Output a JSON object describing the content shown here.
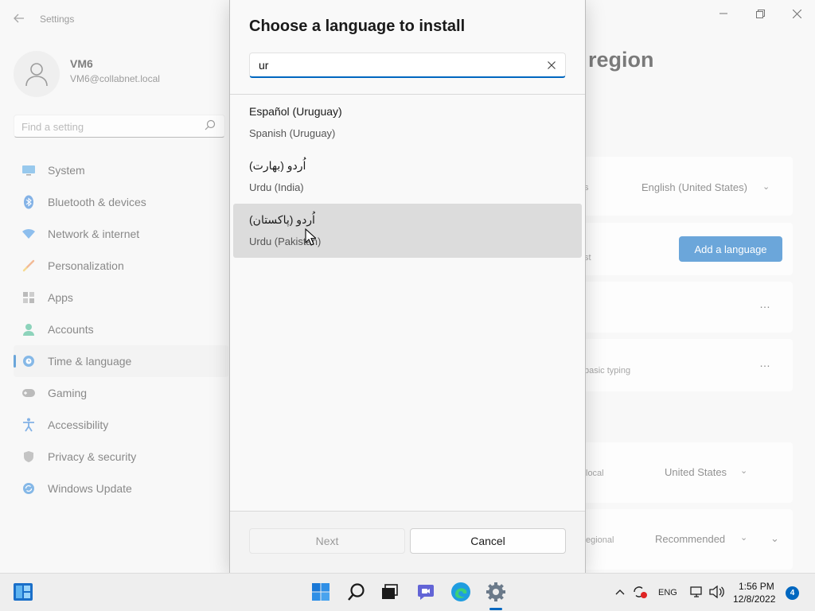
{
  "settings": {
    "app_title": "Settings",
    "user": {
      "name": "VM6",
      "email": "VM6@collabnet.local"
    },
    "search_placeholder": "Find a setting",
    "nav": [
      {
        "label": "System",
        "icon": "monitor-icon"
      },
      {
        "label": "Bluetooth & devices",
        "icon": "bluetooth-icon"
      },
      {
        "label": "Network & internet",
        "icon": "wifi-icon"
      },
      {
        "label": "Personalization",
        "icon": "brush-icon"
      },
      {
        "label": "Apps",
        "icon": "apps-icon"
      },
      {
        "label": "Accounts",
        "icon": "person-icon"
      },
      {
        "label": "Time & language",
        "icon": "globe-clock-icon",
        "active": true
      },
      {
        "label": "Gaming",
        "icon": "gamepad-icon"
      },
      {
        "label": "Accessibility",
        "icon": "accessibility-icon"
      },
      {
        "label": "Privacy & security",
        "icon": "shield-icon"
      },
      {
        "label": "Windows Update",
        "icon": "update-icon"
      }
    ],
    "page_title_fragment": "region",
    "windows_display_language_fragment": "s",
    "display_language_value": "English (United States)",
    "preferred_languages_fragment": "st",
    "add_language_label": "Add a language",
    "basic_typing_fragment": "basic typing",
    "country_fragment": "local",
    "country_value": "United States",
    "regional_format_fragment": "egional",
    "regional_format_value": "Recommended",
    "more_options": "…"
  },
  "dialog": {
    "title": "Choose a language to install",
    "search_value": "ur",
    "languages": [
      {
        "native": "Español (Uruguay)",
        "english": "Spanish (Uruguay)"
      },
      {
        "native": "اُردو (بھارت)",
        "english": "Urdu (India)"
      },
      {
        "native": "اُردو (پاکستان)",
        "english": "Urdu (Pakistan)",
        "hovered": true
      }
    ],
    "next_label": "Next",
    "cancel_label": "Cancel"
  },
  "taskbar": {
    "icons": [
      "start-icon",
      "search-icon",
      "task-view-icon",
      "teams-chat-icon",
      "edge-icon",
      "settings-app-icon"
    ],
    "input_language": "ENG",
    "time": "1:56 PM",
    "date": "12/8/2022",
    "notification_count": "4"
  },
  "colors": {
    "accent": "#0067c0",
    "hover_row": "#dcdcdc",
    "background": "#f3f3f3"
  }
}
